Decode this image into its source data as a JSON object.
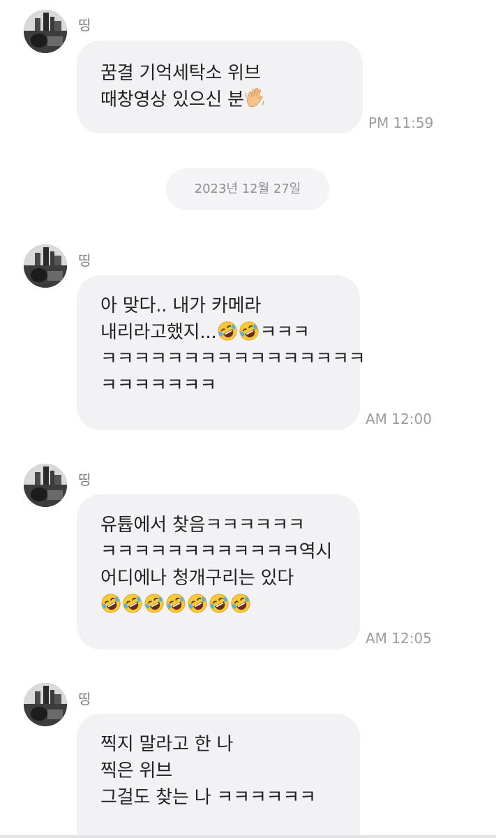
{
  "date_divider": "2023년 12월 27일",
  "messages": [
    {
      "sender": "띵",
      "lines": [
        "꿈결 기억세탁소 위브",
        "때창영상 있으신 분"
      ],
      "emoji_after_last_line": "waving-hand-emoji",
      "time": "PM 11:59"
    },
    {
      "sender": "띵",
      "lines": [
        "아 맞다.. 내가 카메라",
        "내리라고했지...",
        "ㅋㅋㅋㅋㅋㅋㅋㅋㅋㅋㅋㅋㅋㅋㅋㅋ",
        "ㅋㅋㅋㅋㅋㅋㅋ"
      ],
      "line2_suffix": "ㅋㅋㅋ",
      "line2_emojis": [
        "rolling-on-floor-laughing-emoji",
        "rolling-on-floor-laughing-emoji"
      ],
      "time": "AM 12:00"
    },
    {
      "sender": "띵",
      "lines": [
        "유튭에서 찾음ㅋㅋㅋㅋㅋㅋ",
        "ㅋㅋㅋㅋㅋㅋㅋㅋㅋㅋㅋㅋ역시",
        "어디에나 청개구리는 있다"
      ],
      "emoji_line": [
        "rolling-on-floor-laughing-emoji",
        "rolling-on-floor-laughing-emoji",
        "rolling-on-floor-laughing-emoji",
        "rolling-on-floor-laughing-emoji",
        "rolling-on-floor-laughing-emoji",
        "rolling-on-floor-laughing-emoji",
        "rolling-on-floor-laughing-emoji"
      ],
      "time": "AM 12:05"
    },
    {
      "sender": "띵",
      "lines": [
        "찍지 말라고 한 나",
        "찍은 위브",
        "그걸도 찾는 나 ㅋㅋㅋㅋㅋㅋ"
      ]
    }
  ],
  "colors": {
    "bubble": "#f2f2f4",
    "time": "#9b9ba0",
    "sender": "#7a7a7a",
    "text": "#222222"
  }
}
